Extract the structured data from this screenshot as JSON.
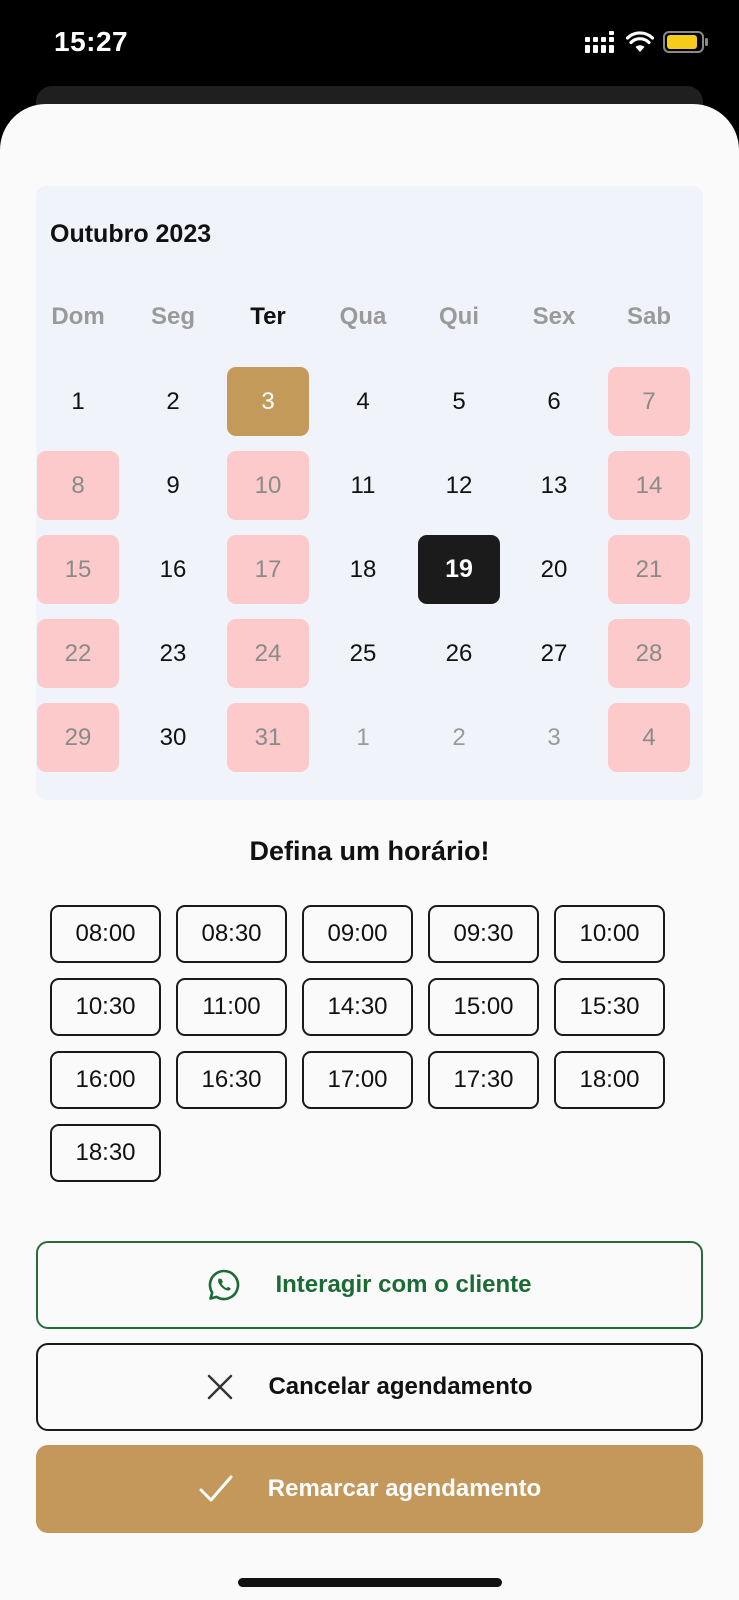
{
  "status_bar": {
    "time": "15:27"
  },
  "calendar": {
    "month_label": "Outubro 2023",
    "weekdays": [
      "Dom",
      "Seg",
      "Ter",
      "Qua",
      "Qui",
      "Sex",
      "Sab"
    ],
    "current_weekday_index": 2,
    "weeks": [
      [
        {
          "day": "1",
          "state": "normal"
        },
        {
          "day": "2",
          "state": "normal"
        },
        {
          "day": "3",
          "state": "today"
        },
        {
          "day": "4",
          "state": "normal"
        },
        {
          "day": "5",
          "state": "normal"
        },
        {
          "day": "6",
          "state": "normal"
        },
        {
          "day": "7",
          "state": "blocked"
        }
      ],
      [
        {
          "day": "8",
          "state": "blocked"
        },
        {
          "day": "9",
          "state": "normal"
        },
        {
          "day": "10",
          "state": "blocked"
        },
        {
          "day": "11",
          "state": "normal"
        },
        {
          "day": "12",
          "state": "normal"
        },
        {
          "day": "13",
          "state": "normal"
        },
        {
          "day": "14",
          "state": "blocked"
        }
      ],
      [
        {
          "day": "15",
          "state": "blocked"
        },
        {
          "day": "16",
          "state": "normal"
        },
        {
          "day": "17",
          "state": "blocked"
        },
        {
          "day": "18",
          "state": "normal"
        },
        {
          "day": "19",
          "state": "selected"
        },
        {
          "day": "20",
          "state": "normal"
        },
        {
          "day": "21",
          "state": "blocked"
        }
      ],
      [
        {
          "day": "22",
          "state": "blocked"
        },
        {
          "day": "23",
          "state": "normal"
        },
        {
          "day": "24",
          "state": "blocked"
        },
        {
          "day": "25",
          "state": "normal"
        },
        {
          "day": "26",
          "state": "normal"
        },
        {
          "day": "27",
          "state": "normal"
        },
        {
          "day": "28",
          "state": "blocked"
        }
      ],
      [
        {
          "day": "29",
          "state": "blocked"
        },
        {
          "day": "30",
          "state": "normal"
        },
        {
          "day": "31",
          "state": "blocked"
        },
        {
          "day": "1",
          "state": "other"
        },
        {
          "day": "2",
          "state": "other"
        },
        {
          "day": "3",
          "state": "other"
        },
        {
          "day": "4",
          "state": "blocked"
        }
      ]
    ]
  },
  "time_picker": {
    "title": "Defina um horário!",
    "slots": [
      "08:00",
      "08:30",
      "09:00",
      "09:30",
      "10:00",
      "10:30",
      "11:00",
      "14:30",
      "15:00",
      "15:30",
      "16:00",
      "16:30",
      "17:00",
      "17:30",
      "18:00",
      "18:30"
    ]
  },
  "actions": {
    "whatsapp": {
      "label": "Interagir com o cliente",
      "icon": "whatsapp-icon",
      "color": "#1c6a36"
    },
    "cancel": {
      "label": "Cancelar agendamento",
      "icon": "close-icon"
    },
    "reschedule": {
      "label": "Remarcar agendamento",
      "icon": "check-icon",
      "color": "#c4975a"
    }
  },
  "colors": {
    "accent": "#c49a5a",
    "blocked_day": "#fccaca",
    "selected_day": "#1b1b1b",
    "calendar_bg": "#f0f3f9"
  }
}
